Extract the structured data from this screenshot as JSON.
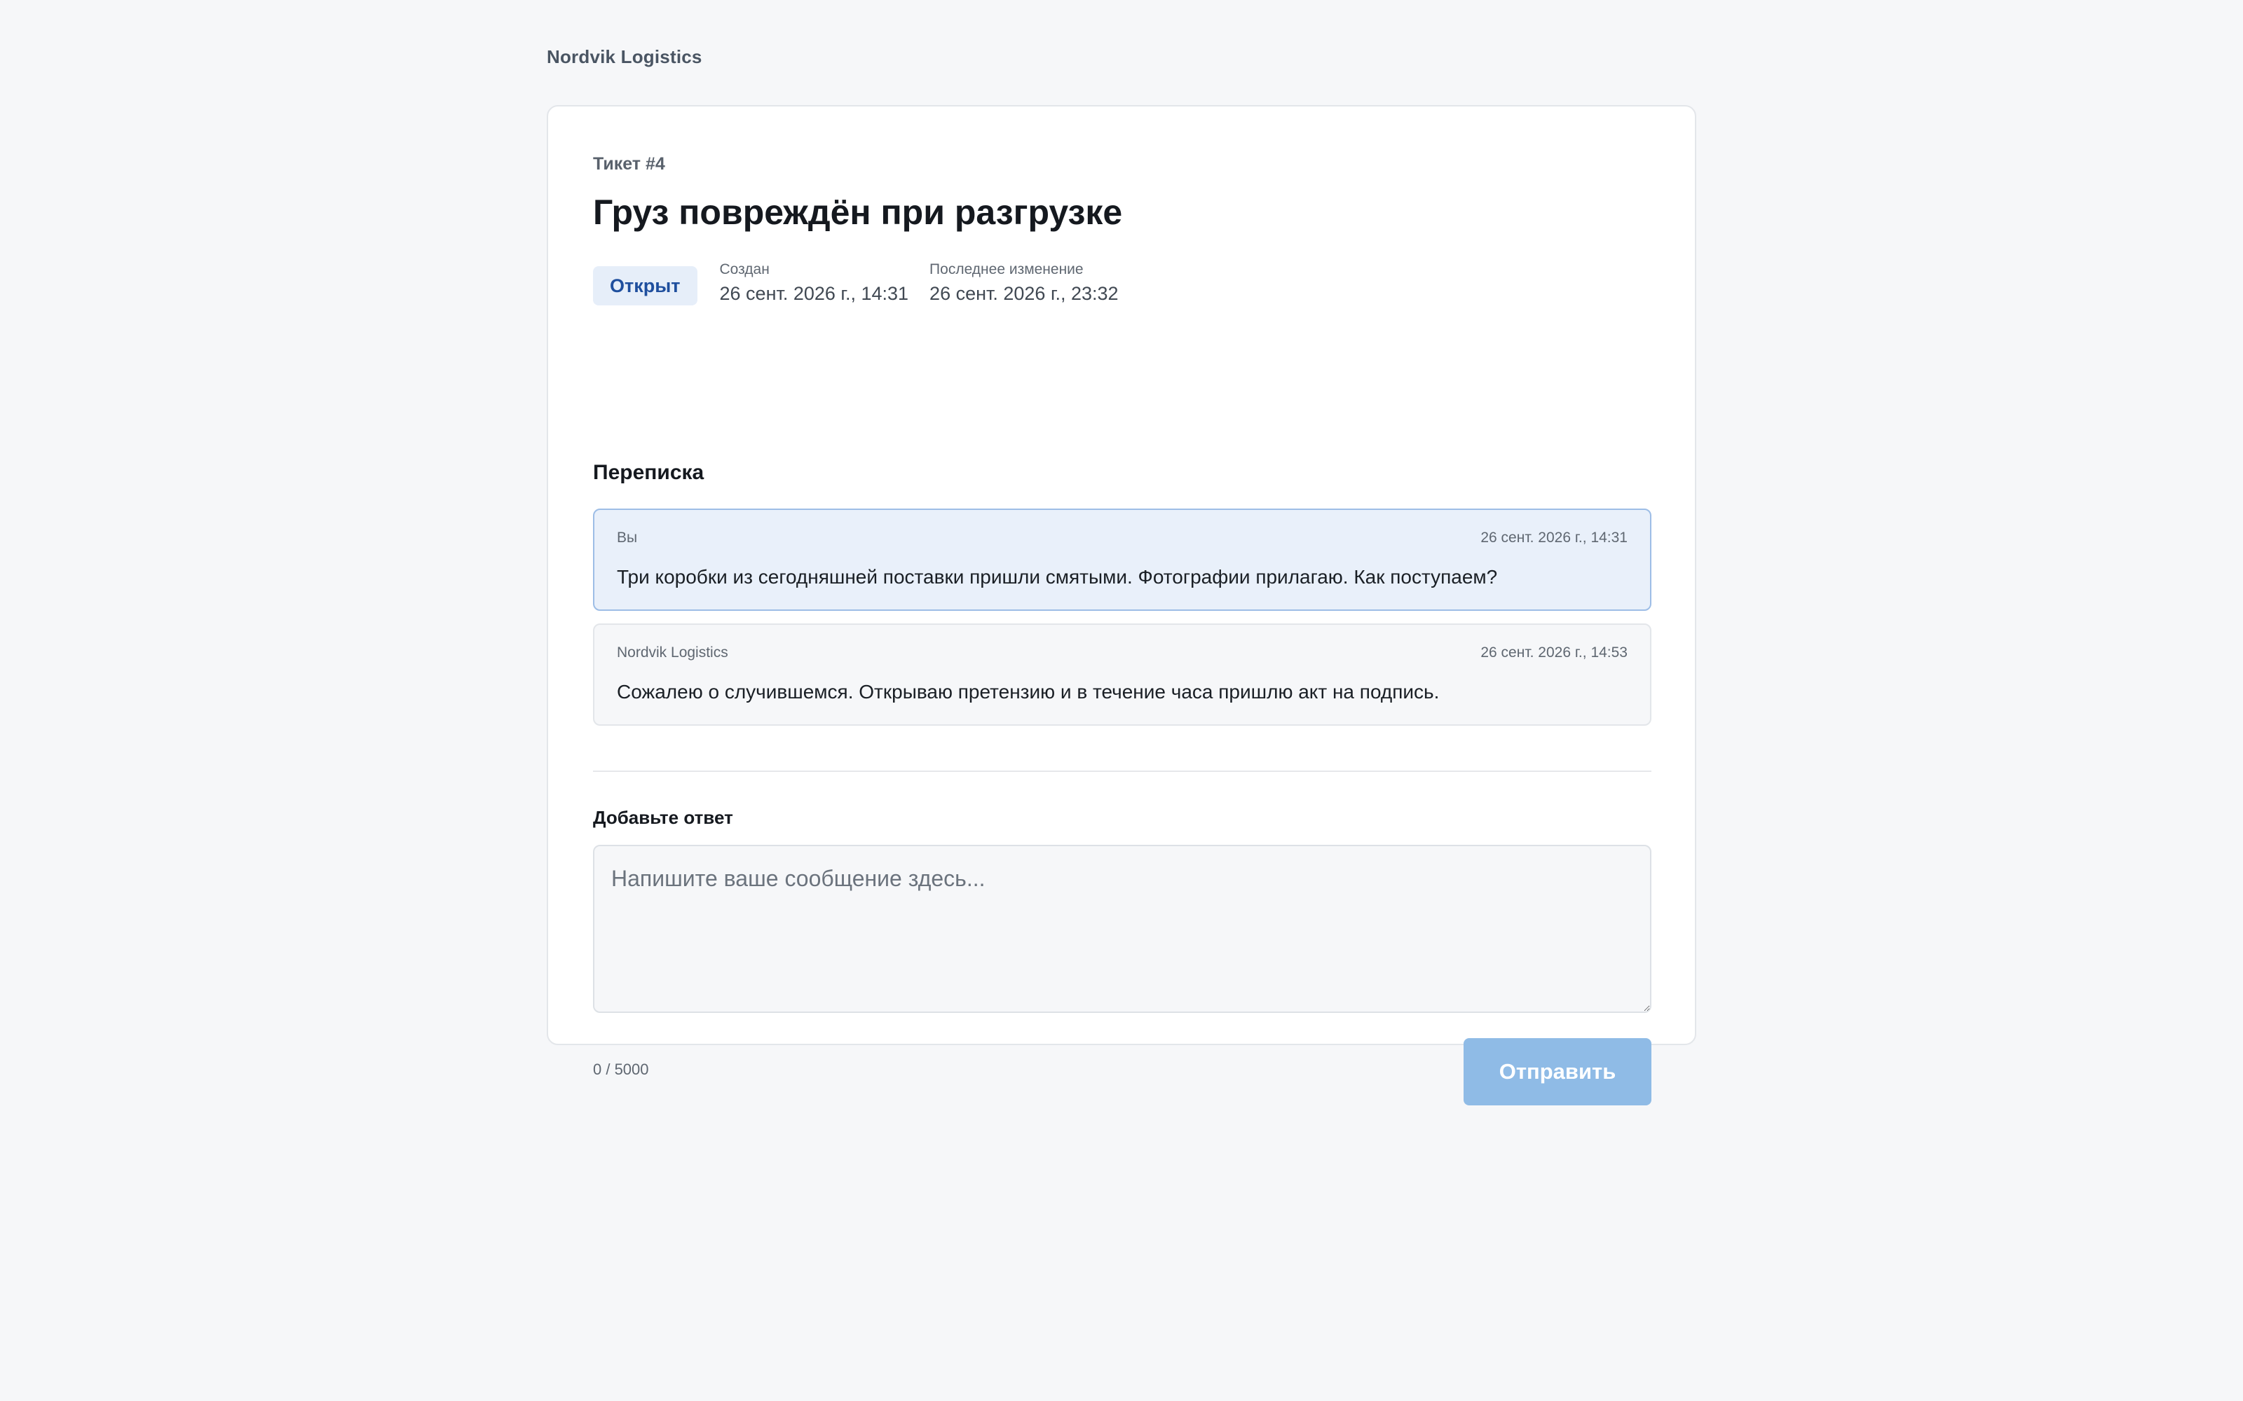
{
  "header": {
    "brand": "Nordvik Logistics"
  },
  "ticket": {
    "id_label": "Тикет #4",
    "title": "Груз повреждён при разгрузке",
    "status": "Открыт",
    "created_label": "Создан",
    "created_value": "26 сент. 2026 г., 14:31",
    "updated_label": "Последнее изменение",
    "updated_value": "26 сент. 2026 г., 23:32"
  },
  "conversation": {
    "title": "Переписка",
    "messages": [
      {
        "author": "Вы",
        "time": "26 сент. 2026 г., 14:31",
        "text": "Три коробки из сегодняшней поставки пришли смятыми. Фотографии прилагаю. Как поступаем?"
      },
      {
        "author": "Nordvik Logistics",
        "time": "26 сент. 2026 г., 14:53",
        "text": "Сожалею о случившемся. Открываю претензию и в течение часа пришлю акт на подпись."
      }
    ]
  },
  "reply": {
    "label": "Добавьте ответ",
    "placeholder": "Напишите ваше сообщение здесь...",
    "value": "",
    "char_count": "0 / 5000",
    "send_label": "Отправить"
  },
  "colors": {
    "accent": "#8fbbe6",
    "status_bg": "#e6eef9",
    "status_text": "#1f4f9e",
    "own_message_bg": "#e9f0fa"
  }
}
